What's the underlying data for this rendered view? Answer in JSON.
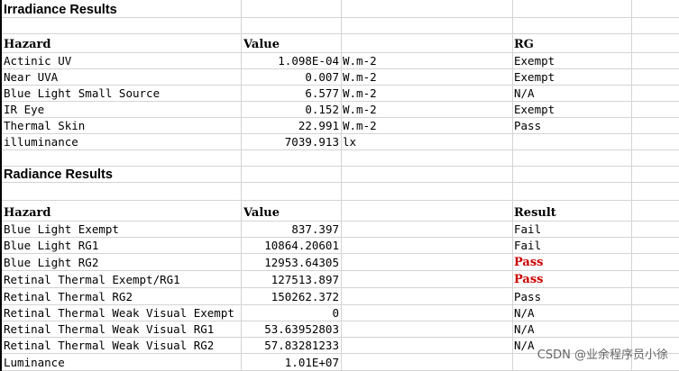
{
  "irradiance": {
    "title": "Irradiance Results",
    "headers": {
      "hazard": "Hazard",
      "value": "Value",
      "rg": "RG"
    },
    "rows": [
      {
        "hazard": "Actinic UV",
        "value": "1.098E-04",
        "unit": "W.m-2",
        "rg": "Exempt"
      },
      {
        "hazard": "Near UVA",
        "value": "0.007",
        "unit": "W.m-2",
        "rg": "Exempt"
      },
      {
        "hazard": "Blue Light Small Source",
        "value": "6.577",
        "unit": "W.m-2",
        "rg": "N/A"
      },
      {
        "hazard": "IR Eye",
        "value": "0.152",
        "unit": "W.m-2",
        "rg": "Exempt"
      },
      {
        "hazard": "Thermal Skin",
        "value": "22.991",
        "unit": "W.m-2",
        "rg": "Pass"
      },
      {
        "hazard": "illuminance",
        "value": "7039.913",
        "unit": "lx",
        "rg": ""
      }
    ]
  },
  "radiance": {
    "title": "Radiance Results",
    "headers": {
      "hazard": "Hazard",
      "value": "Value",
      "result": "Result"
    },
    "rows": [
      {
        "hazard": "Blue Light Exempt",
        "value": "837.397",
        "result": "Fail",
        "highlight": false
      },
      {
        "hazard": "Blue Light RG1",
        "value": "10864.20601",
        "result": "Fail",
        "highlight": false
      },
      {
        "hazard": "Blue Light RG2",
        "value": "12953.64305",
        "result": "Pass",
        "highlight": true
      },
      {
        "hazard": "Retinal Thermal Exempt/RG1",
        "value": "127513.897",
        "result": "Pass",
        "highlight": true
      },
      {
        "hazard": "Retinal Thermal RG2",
        "value": "150262.372",
        "result": "Pass",
        "highlight": false
      },
      {
        "hazard": "Retinal Thermal Weak Visual Exempt",
        "value": "0",
        "result": "N/A",
        "highlight": false
      },
      {
        "hazard": "Retinal Thermal Weak Visual RG1",
        "value": "53.63952803",
        "result": "N/A",
        "highlight": false
      },
      {
        "hazard": "Retinal Thermal Weak Visual RG2",
        "value": "57.83281233",
        "result": "N/A",
        "highlight": false
      },
      {
        "hazard": "Luminance",
        "value": "1.01E+07",
        "result": "",
        "highlight": false
      }
    ]
  },
  "highlight_color": "#cc0000",
  "watermark": "CSDN @业余程序员小徐"
}
